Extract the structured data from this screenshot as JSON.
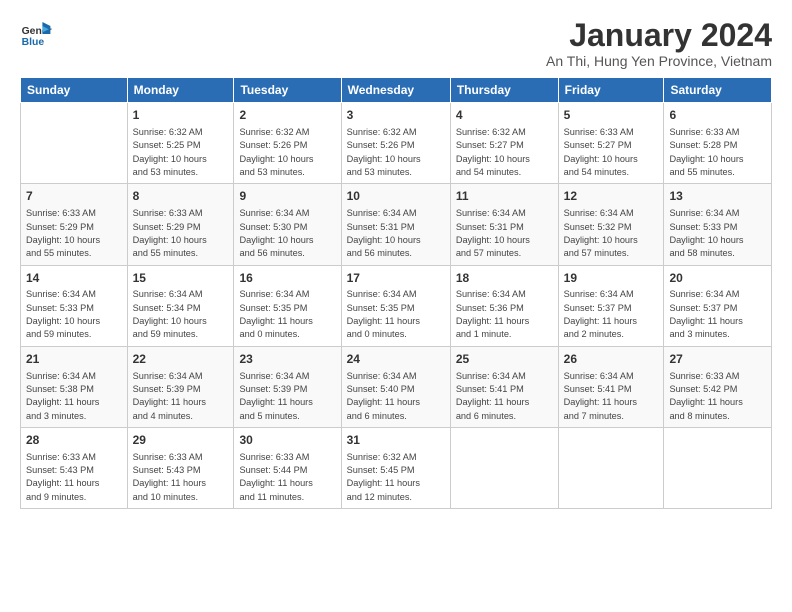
{
  "logo": {
    "line1": "General",
    "line2": "Blue"
  },
  "title": "January 2024",
  "subtitle": "An Thi, Hung Yen Province, Vietnam",
  "days_header": [
    "Sunday",
    "Monday",
    "Tuesday",
    "Wednesday",
    "Thursday",
    "Friday",
    "Saturday"
  ],
  "weeks": [
    [
      {
        "day": "",
        "content": ""
      },
      {
        "day": "1",
        "content": "Sunrise: 6:32 AM\nSunset: 5:25 PM\nDaylight: 10 hours\nand 53 minutes."
      },
      {
        "day": "2",
        "content": "Sunrise: 6:32 AM\nSunset: 5:26 PM\nDaylight: 10 hours\nand 53 minutes."
      },
      {
        "day": "3",
        "content": "Sunrise: 6:32 AM\nSunset: 5:26 PM\nDaylight: 10 hours\nand 53 minutes."
      },
      {
        "day": "4",
        "content": "Sunrise: 6:32 AM\nSunset: 5:27 PM\nDaylight: 10 hours\nand 54 minutes."
      },
      {
        "day": "5",
        "content": "Sunrise: 6:33 AM\nSunset: 5:27 PM\nDaylight: 10 hours\nand 54 minutes."
      },
      {
        "day": "6",
        "content": "Sunrise: 6:33 AM\nSunset: 5:28 PM\nDaylight: 10 hours\nand 55 minutes."
      }
    ],
    [
      {
        "day": "7",
        "content": "Sunrise: 6:33 AM\nSunset: 5:29 PM\nDaylight: 10 hours\nand 55 minutes."
      },
      {
        "day": "8",
        "content": "Sunrise: 6:33 AM\nSunset: 5:29 PM\nDaylight: 10 hours\nand 55 minutes."
      },
      {
        "day": "9",
        "content": "Sunrise: 6:34 AM\nSunset: 5:30 PM\nDaylight: 10 hours\nand 56 minutes."
      },
      {
        "day": "10",
        "content": "Sunrise: 6:34 AM\nSunset: 5:31 PM\nDaylight: 10 hours\nand 56 minutes."
      },
      {
        "day": "11",
        "content": "Sunrise: 6:34 AM\nSunset: 5:31 PM\nDaylight: 10 hours\nand 57 minutes."
      },
      {
        "day": "12",
        "content": "Sunrise: 6:34 AM\nSunset: 5:32 PM\nDaylight: 10 hours\nand 57 minutes."
      },
      {
        "day": "13",
        "content": "Sunrise: 6:34 AM\nSunset: 5:33 PM\nDaylight: 10 hours\nand 58 minutes."
      }
    ],
    [
      {
        "day": "14",
        "content": "Sunrise: 6:34 AM\nSunset: 5:33 PM\nDaylight: 10 hours\nand 59 minutes."
      },
      {
        "day": "15",
        "content": "Sunrise: 6:34 AM\nSunset: 5:34 PM\nDaylight: 10 hours\nand 59 minutes."
      },
      {
        "day": "16",
        "content": "Sunrise: 6:34 AM\nSunset: 5:35 PM\nDaylight: 11 hours\nand 0 minutes."
      },
      {
        "day": "17",
        "content": "Sunrise: 6:34 AM\nSunset: 5:35 PM\nDaylight: 11 hours\nand 0 minutes."
      },
      {
        "day": "18",
        "content": "Sunrise: 6:34 AM\nSunset: 5:36 PM\nDaylight: 11 hours\nand 1 minute."
      },
      {
        "day": "19",
        "content": "Sunrise: 6:34 AM\nSunset: 5:37 PM\nDaylight: 11 hours\nand 2 minutes."
      },
      {
        "day": "20",
        "content": "Sunrise: 6:34 AM\nSunset: 5:37 PM\nDaylight: 11 hours\nand 3 minutes."
      }
    ],
    [
      {
        "day": "21",
        "content": "Sunrise: 6:34 AM\nSunset: 5:38 PM\nDaylight: 11 hours\nand 3 minutes."
      },
      {
        "day": "22",
        "content": "Sunrise: 6:34 AM\nSunset: 5:39 PM\nDaylight: 11 hours\nand 4 minutes."
      },
      {
        "day": "23",
        "content": "Sunrise: 6:34 AM\nSunset: 5:39 PM\nDaylight: 11 hours\nand 5 minutes."
      },
      {
        "day": "24",
        "content": "Sunrise: 6:34 AM\nSunset: 5:40 PM\nDaylight: 11 hours\nand 6 minutes."
      },
      {
        "day": "25",
        "content": "Sunrise: 6:34 AM\nSunset: 5:41 PM\nDaylight: 11 hours\nand 6 minutes."
      },
      {
        "day": "26",
        "content": "Sunrise: 6:34 AM\nSunset: 5:41 PM\nDaylight: 11 hours\nand 7 minutes."
      },
      {
        "day": "27",
        "content": "Sunrise: 6:33 AM\nSunset: 5:42 PM\nDaylight: 11 hours\nand 8 minutes."
      }
    ],
    [
      {
        "day": "28",
        "content": "Sunrise: 6:33 AM\nSunset: 5:43 PM\nDaylight: 11 hours\nand 9 minutes."
      },
      {
        "day": "29",
        "content": "Sunrise: 6:33 AM\nSunset: 5:43 PM\nDaylight: 11 hours\nand 10 minutes."
      },
      {
        "day": "30",
        "content": "Sunrise: 6:33 AM\nSunset: 5:44 PM\nDaylight: 11 hours\nand 11 minutes."
      },
      {
        "day": "31",
        "content": "Sunrise: 6:32 AM\nSunset: 5:45 PM\nDaylight: 11 hours\nand 12 minutes."
      },
      {
        "day": "",
        "content": ""
      },
      {
        "day": "",
        "content": ""
      },
      {
        "day": "",
        "content": ""
      }
    ]
  ]
}
